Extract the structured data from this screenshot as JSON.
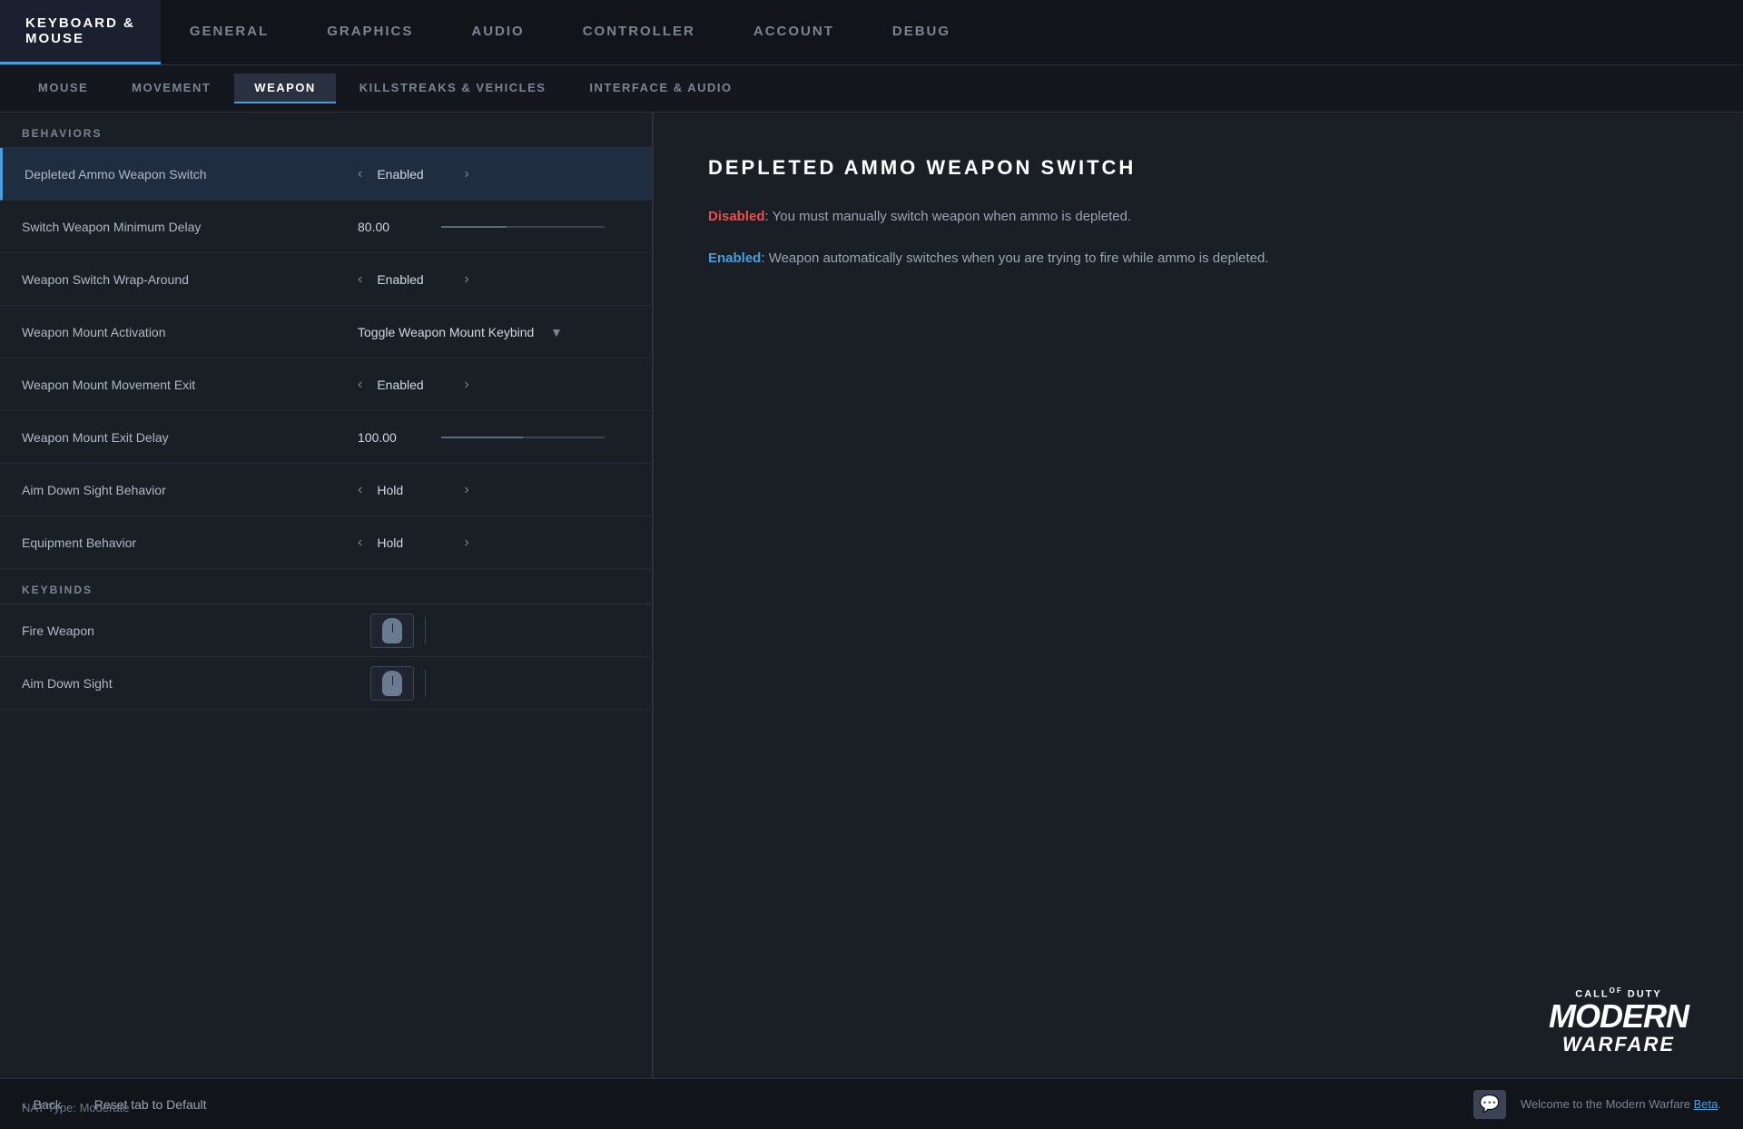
{
  "topNav": {
    "items": [
      {
        "id": "keyboard-mouse",
        "label": "KEYBOARD &\nMOUSE",
        "active": true
      },
      {
        "id": "general",
        "label": "GENERAL",
        "active": false
      },
      {
        "id": "graphics",
        "label": "GRAPHICS",
        "active": false
      },
      {
        "id": "audio",
        "label": "AUDIO",
        "active": false
      },
      {
        "id": "controller",
        "label": "CONTROLLER",
        "active": false
      },
      {
        "id": "account",
        "label": "ACCOUNT",
        "active": false
      },
      {
        "id": "debug",
        "label": "DEBUG",
        "active": false
      }
    ]
  },
  "subNav": {
    "items": [
      {
        "id": "mouse",
        "label": "MOUSE",
        "active": false
      },
      {
        "id": "movement",
        "label": "MOVEMENT",
        "active": false
      },
      {
        "id": "weapon",
        "label": "WEAPON",
        "active": true
      },
      {
        "id": "killstreaks",
        "label": "KILLSTREAKS & VEHICLES",
        "active": false
      },
      {
        "id": "interface",
        "label": "INTERFACE & AUDIO",
        "active": false
      }
    ]
  },
  "sections": {
    "behaviors": {
      "header": "BEHAVIORS",
      "rows": [
        {
          "id": "depleted-ammo",
          "label": "Depleted Ammo Weapon Switch",
          "controlType": "toggle",
          "value": "Enabled",
          "selected": true
        },
        {
          "id": "switch-delay",
          "label": "Switch Weapon Minimum Delay",
          "controlType": "slider",
          "value": "80.00",
          "sliderPercent": 40,
          "selected": false
        },
        {
          "id": "wrap-around",
          "label": "Weapon Switch Wrap-Around",
          "controlType": "toggle",
          "value": "Enabled",
          "selected": false
        },
        {
          "id": "mount-activation",
          "label": "Weapon Mount Activation",
          "controlType": "dropdown",
          "value": "Toggle Weapon Mount Keybind",
          "selected": false
        },
        {
          "id": "mount-exit",
          "label": "Weapon Mount Movement Exit",
          "controlType": "toggle",
          "value": "Enabled",
          "selected": false
        },
        {
          "id": "mount-exit-delay",
          "label": "Weapon Mount Exit Delay",
          "controlType": "slider",
          "value": "100.00",
          "sliderPercent": 50,
          "selected": false
        },
        {
          "id": "aim-behavior",
          "label": "Aim Down Sight Behavior",
          "controlType": "toggle",
          "value": "Hold",
          "selected": false
        },
        {
          "id": "equipment-behavior",
          "label": "Equipment Behavior",
          "controlType": "toggle",
          "value": "Hold",
          "selected": false
        }
      ]
    },
    "keybinds": {
      "header": "KEYBINDS",
      "rows": [
        {
          "id": "fire-weapon",
          "label": "Fire Weapon",
          "keys": [
            "mouse-left",
            "",
            ""
          ]
        },
        {
          "id": "aim-down-sight",
          "label": "Aim Down Sight",
          "keys": [
            "mouse-right",
            "",
            ""
          ]
        }
      ]
    }
  },
  "detail": {
    "title": "DEPLETED AMMO WEAPON SWITCH",
    "descriptions": [
      {
        "prefix": "Disabled",
        "prefixType": "disabled",
        "text": ": You must manually switch weapon when ammo is depleted."
      },
      {
        "prefix": "Enabled",
        "prefixType": "enabled",
        "text": ": Weapon automatically switches when you are trying to fire while ammo is depleted."
      }
    ]
  },
  "bottomBar": {
    "natType": "NAT Type: Moderate",
    "backLabel": "Back",
    "resetLabel": "Reset tab to Default",
    "welcomeText": "Welcome to the Modern Warfare Beta",
    "betaWord": "Beta",
    "chatIcon": "💬"
  },
  "logo": {
    "callOf": "CALL OF DUTY",
    "modern": "MODERN",
    "warfare": "WARFARE"
  }
}
